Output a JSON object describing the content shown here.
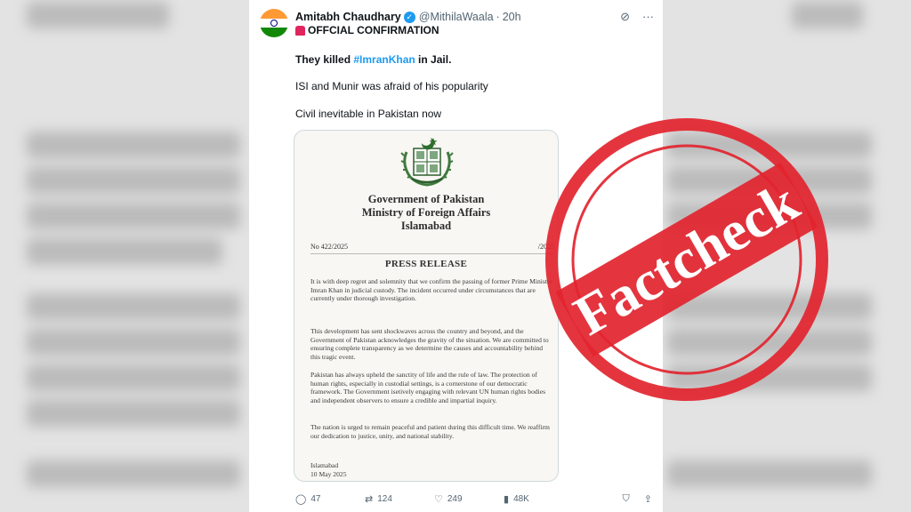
{
  "colors": {
    "stamp_red": "#e2242f",
    "link_blue": "#1d9bf0",
    "verified_blue": "#1d9bf0",
    "text_dark": "#0f1419",
    "text_muted": "#536471"
  },
  "tweet": {
    "author_name": "Amitabh Chaudhary",
    "verified_icon": "verified-badge-icon",
    "handle": "@MithilaWaala",
    "separator": "·",
    "time": "20h",
    "grok_icon": "grok-icon",
    "more_icon": "more-dots-icon",
    "line1_icon": "siren-icon",
    "line1": "OFFCIAL CONFIRMATION",
    "line2_pre": "They killed ",
    "line2_tag": "#ImranKhan",
    "line2_post": " in Jail.",
    "line3": "ISI and Munir was afraid of his popularity",
    "line4": "Civil inevitable in Pakistan now"
  },
  "document": {
    "emblem_icon": "pakistan-emblem-icon",
    "gov_line1": "Government of Pakistan",
    "gov_line2": "Ministry of Foreign Affairs",
    "gov_line3": "Islamabad",
    "number": "No 422/2025",
    "date_stub": "/2025",
    "title": "PRESS RELEASE",
    "para1": "It is with deep regret and solemnity that we confirm the passing of former Prime Minister Imran Khan in judicial custody. The incident occurred under circumstances that are currently under thorough investigation.",
    "para2": "This development has sent shockwaves across the country and beyond, and the Government of Pakistan acknowledges the gravity of the situation. We are committed to ensuring complete transparency as we determine the causes and accountability behind this tragic event.",
    "para3": "Pakistan has always upheld the sanctity of life and the rule of law. The protection of human rights, especially in custodial settings, is a cornerstone of our democratic framework. The Government isetively engaging with relevant UN human rights bodies and independent observers to ensure a credible and impartial inquiry.",
    "para4": "The nation is urged to remain peaceful and patient during this difficult time. We reaffirm our dedication to justice, unity, and national stability.",
    "sign_place": "Islamabad",
    "sign_date": "10 May 2025"
  },
  "actions": {
    "replies": "47",
    "reposts": "124",
    "likes": "249",
    "views": "48K",
    "reply_icon": "reply-icon",
    "repost_icon": "repost-icon",
    "like_icon": "heart-icon",
    "views_icon": "views-chart-icon",
    "bookmark_icon": "bookmark-icon",
    "share_icon": "share-icon"
  },
  "stamp": {
    "text": "Factcheck"
  }
}
